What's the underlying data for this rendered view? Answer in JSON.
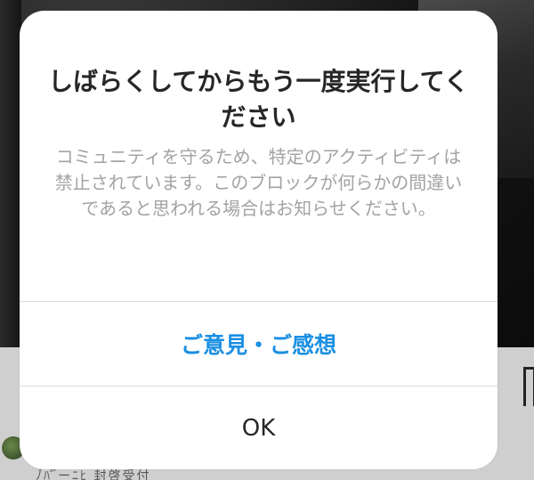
{
  "background": {
    "caption_text": "ﾉ゙ﾊﾟ゙ーﾆﾋ 封啓受付"
  },
  "alert": {
    "title": "しばらくしてからもう一度実行してください",
    "message": "コミュニティを守るため、特定のアクティビティは禁止されています。このブロックが何らかの間違いであると思われる場合はお知らせください。",
    "buttons": {
      "feedback_label": "ご意見・ご感想",
      "ok_label": "OK"
    }
  },
  "colors": {
    "accent_blue": "#1a8fe3",
    "title_text": "#262626",
    "message_text": "#a3a3a3",
    "divider": "#dbdbdb"
  }
}
